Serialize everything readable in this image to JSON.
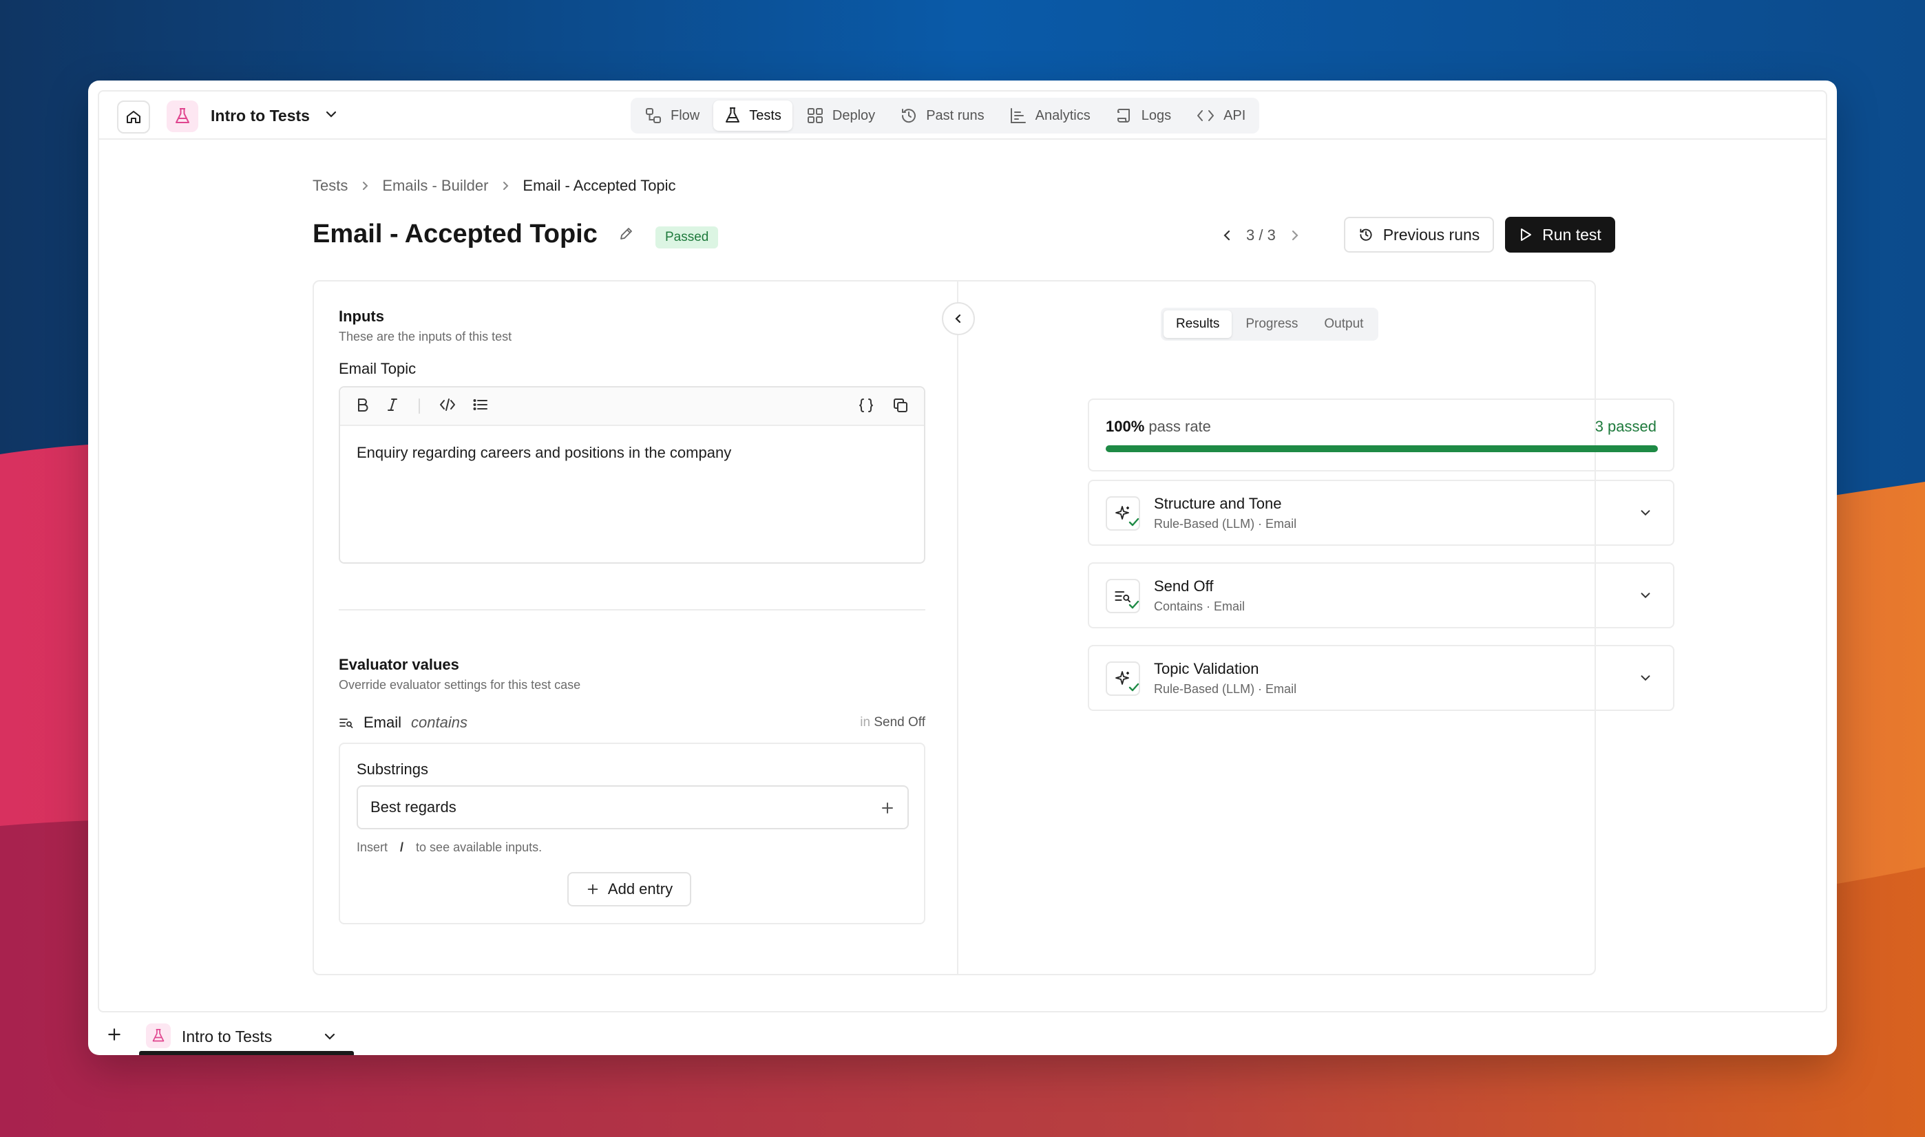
{
  "colors": {
    "accent_dark": "#151515",
    "pass_green": "#1e8a45",
    "badge_bg": "#dcf5e3",
    "app_icon_bg": "#fde7f2",
    "app_icon_fg": "#e0468f"
  },
  "app": {
    "title": "Intro to Tests",
    "icon": "flask-icon"
  },
  "nav": {
    "tabs": [
      {
        "label": "Flow",
        "icon": "flow-icon"
      },
      {
        "label": "Tests",
        "icon": "flask-icon",
        "active": true
      },
      {
        "label": "Deploy",
        "icon": "grid-icon"
      },
      {
        "label": "Past runs",
        "icon": "history-icon"
      },
      {
        "label": "Analytics",
        "icon": "bar-chart-icon"
      },
      {
        "label": "Logs",
        "icon": "scroll-icon"
      },
      {
        "label": "API",
        "icon": "code-icon"
      }
    ]
  },
  "breadcrumb": {
    "items": [
      "Tests",
      "Emails - Builder",
      "Email - Accepted Topic"
    ]
  },
  "header": {
    "title": "Email - Accepted Topic",
    "status": "Passed",
    "pager": "3 / 3",
    "previous_runs_label": "Previous runs",
    "run_label": "Run test"
  },
  "inputs": {
    "title": "Inputs",
    "subtitle": "These are the inputs of this test",
    "field_label": "Email Topic",
    "field_value": "Enquiry regarding careers and positions in the company"
  },
  "evaluator": {
    "title": "Evaluator values",
    "subtitle": "Override evaluator settings for this test case",
    "row_name": "Email",
    "row_op": "contains",
    "row_in_prefix": "in",
    "row_in_target": "Send Off",
    "substrings_label": "Substrings",
    "substring_value": "Best regards",
    "hint_prefix": "Insert",
    "hint_key": "/",
    "hint_suffix": "to see available inputs.",
    "add_entry_label": "Add entry"
  },
  "results": {
    "tabs": [
      {
        "label": "Results",
        "active": true
      },
      {
        "label": "Progress"
      },
      {
        "label": "Output"
      }
    ],
    "pass_rate_value": "100%",
    "pass_rate_label": "pass rate",
    "pass_fraction": 1.0,
    "passed_label": "3 passed",
    "evaluators": [
      {
        "name": "Structure and Tone",
        "meta": "Rule-Based (LLM) · Email",
        "icon": "sparkle-icon"
      },
      {
        "name": "Send Off",
        "meta": "Contains · Email",
        "icon": "text-search-icon"
      },
      {
        "name": "Topic Validation",
        "meta": "Rule-Based (LLM) · Email",
        "icon": "sparkle-icon"
      }
    ]
  },
  "bottombar": {
    "title": "Intro to Tests"
  }
}
